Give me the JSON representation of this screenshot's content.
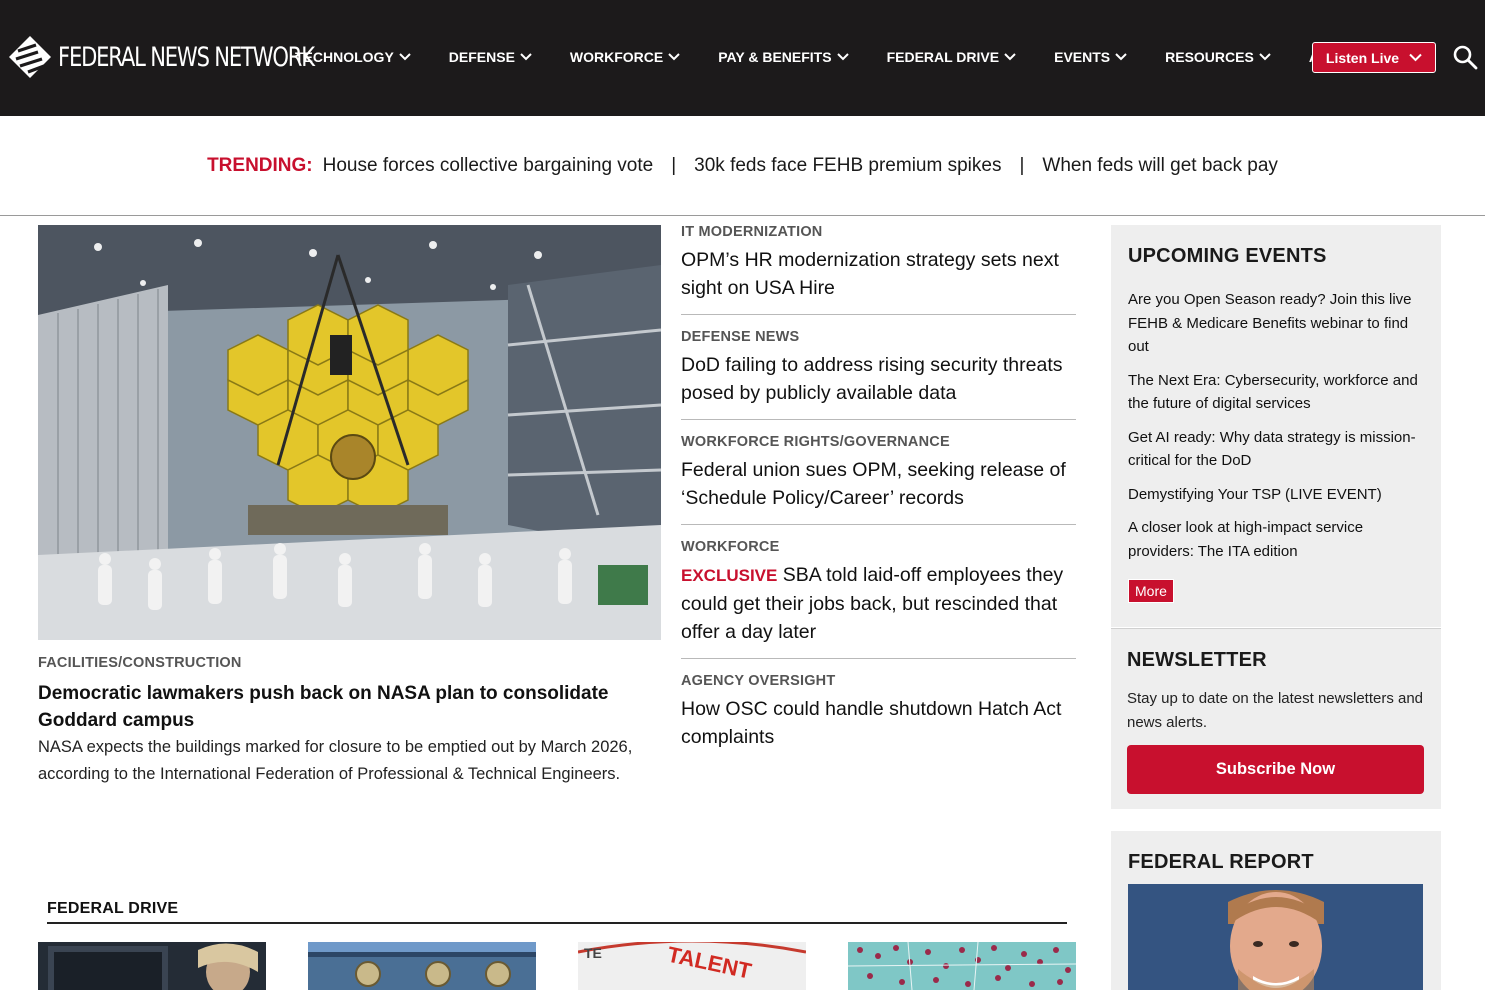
{
  "header": {
    "logo_text": "FEDERAL NEWS NETWORK",
    "nav": [
      "TECHNOLOGY",
      "DEFENSE",
      "WORKFORCE",
      "PAY & BENEFITS",
      "FEDERAL DRIVE",
      "EVENTS",
      "RESOURCES",
      "ADVERTISE"
    ],
    "listen_label": "Listen Live",
    "search_icon": "search-icon",
    "colors": {
      "bar": "#1c1a1b",
      "accent": "#c8102e"
    }
  },
  "trending": {
    "label": "TRENDING:",
    "links": [
      "House forces collective bargaining vote",
      "30k feds face FEHB premium spikes",
      "When feds will get back pay"
    ],
    "separator": "|"
  },
  "hero": {
    "kicker": "FACILITIES/CONSTRUCTION",
    "title": "Democratic lawmakers push back on NASA plan to consolidate Goddard campus",
    "desc": "NASA expects the buildings marked for closure to be emptied out by March 2026, according to the International Federation of Professional & Technical Engineers."
  },
  "stories": [
    {
      "kicker": "IT MODERNIZATION",
      "headline": "OPM’s HR modernization strategy sets next sight on USA Hire"
    },
    {
      "kicker": "DEFENSE NEWS",
      "headline": "DoD failing to address rising security threats posed by publicly available data"
    },
    {
      "kicker": "WORKFORCE RIGHTS/GOVERNANCE",
      "headline": "Federal union sues OPM, seeking release of ‘Schedule Policy/Career’ records"
    },
    {
      "kicker": "WORKFORCE",
      "badge": "EXCLUSIVE",
      "headline": "SBA told laid-off employees they could get their jobs back, but rescinded that offer a day later"
    },
    {
      "kicker": "AGENCY OVERSIGHT",
      "headline": "How OSC could handle shutdown Hatch Act complaints"
    }
  ],
  "events": {
    "title": "UPCOMING EVENTS",
    "items": [
      "Are you Open Season ready? Join this live FEHB & Medicare Benefits webinar to find out",
      "The Next Era: Cybersecurity, workforce and the future of digital services",
      "Get AI ready: Why data strategy is mission-critical for the DoD",
      "Demystifying Your TSP (LIVE EVENT)",
      "A closer look at high-impact service providers: The ITA edition"
    ],
    "more_label": "More"
  },
  "newsletter": {
    "title": "NEWSLETTER",
    "desc": "Stay up to date on the latest newsletters and news alerts.",
    "button": "Subscribe Now"
  },
  "report": {
    "title": "FEDERAL REPORT"
  },
  "federal_drive": {
    "title": "FEDERAL DRIVE",
    "thumb_text_3": "TALENT"
  }
}
